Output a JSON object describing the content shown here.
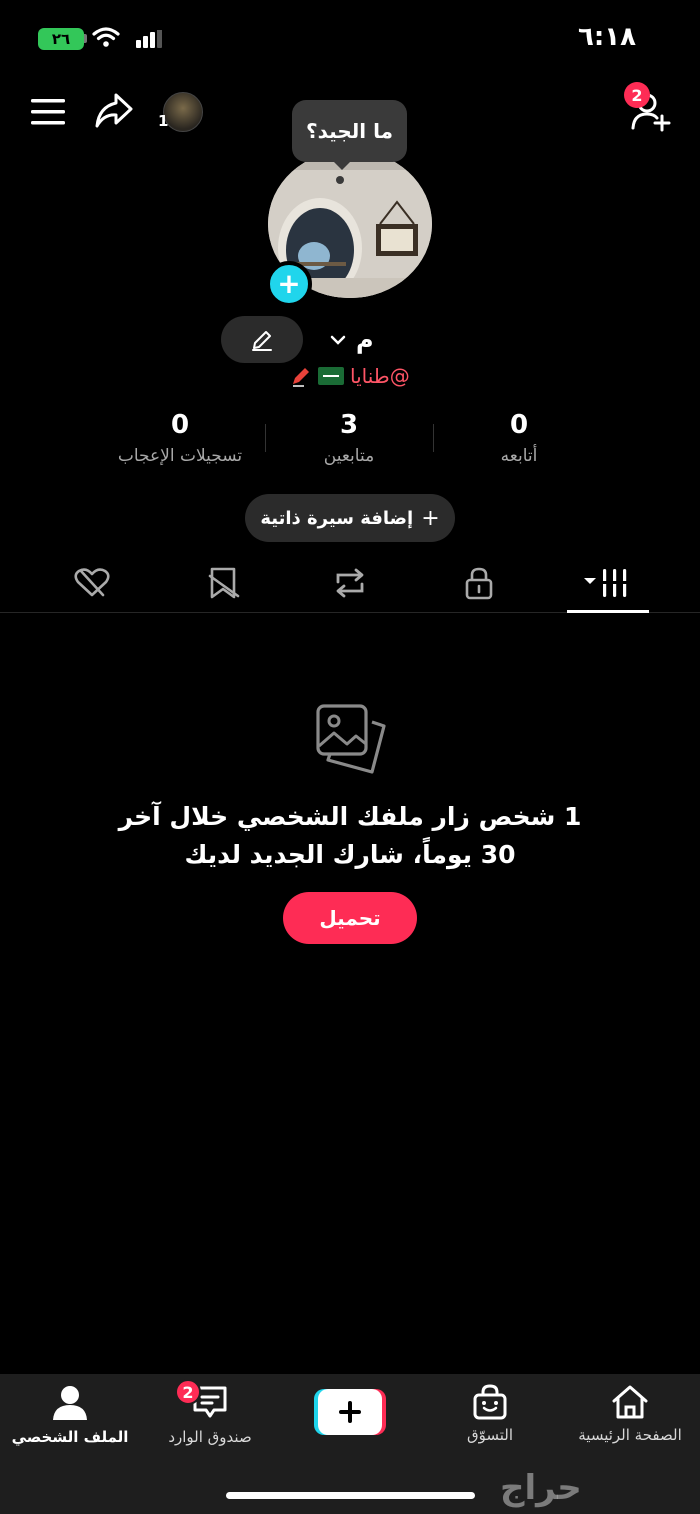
{
  "status_bar": {
    "time": "٦:١٨",
    "battery": "٢٦"
  },
  "header": {
    "avatar_count": "1",
    "friends_badge": "2",
    "icons": [
      "menu-icon",
      "share-icon",
      "add-friend-icon"
    ]
  },
  "profile": {
    "tooltip": "ما الجيد؟",
    "name": "م",
    "handle": "@طنايا",
    "stats": [
      {
        "value": "0",
        "label": "أتابعه"
      },
      {
        "value": "3",
        "label": "متابعين"
      },
      {
        "value": "0",
        "label": "تسجيلات الإعجاب"
      }
    ],
    "bio_button": "إضافة سيرة ذاتية"
  },
  "tabs": [
    "videos-tab",
    "private-tab",
    "reposts-tab",
    "favorites-tab",
    "liked-tab"
  ],
  "empty_state": {
    "line1": "1 شخص زار ملفك الشخصي خلال آخر",
    "line2": "30 يوماً، شارك الجديد لديك",
    "upload_button": "تحميل"
  },
  "bottom_nav": {
    "home": "الصفحة الرئيسية",
    "shop": "التسوّق",
    "inbox": "صندوق الوارد",
    "inbox_badge": "2",
    "profile": "الملف الشخصي"
  },
  "watermark": "حراج",
  "colors": {
    "accent": "#fe2c55",
    "cyan": "#20d5ec",
    "background": "#000000"
  }
}
